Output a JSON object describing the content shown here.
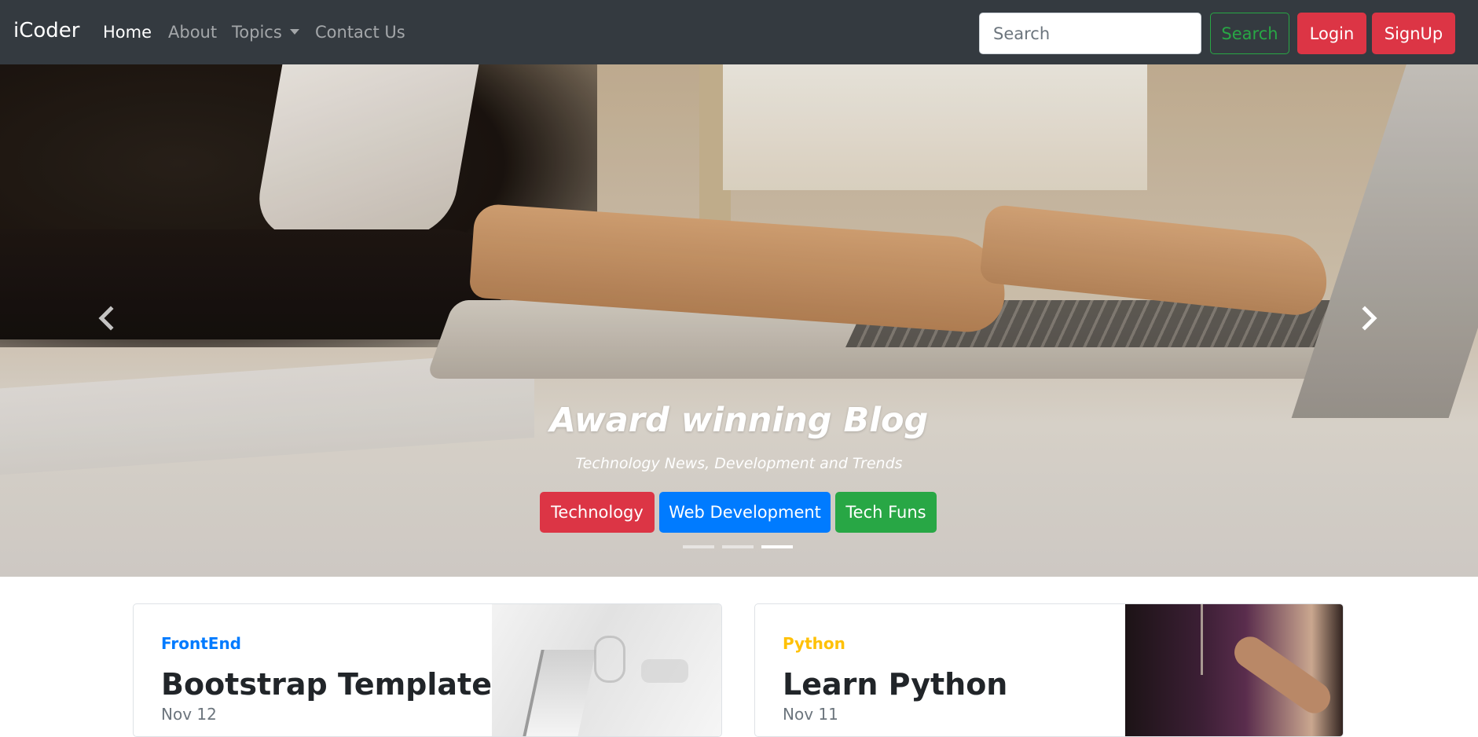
{
  "navbar": {
    "brand": "iCoder",
    "links": [
      {
        "label": "Home",
        "active": true
      },
      {
        "label": "About"
      },
      {
        "label": "Topics",
        "dropdown": true
      },
      {
        "label": "Contact Us"
      }
    ],
    "search_placeholder": "Search",
    "search_button": "Search",
    "login_button": "Login",
    "signup_button": "SignUp"
  },
  "carousel": {
    "title": "Award winning Blog",
    "subtitle": "Technology News, Development and Trends",
    "buttons": [
      {
        "label": "Technology",
        "color": "#dc3545"
      },
      {
        "label": "Web Development",
        "color": "#007bff"
      },
      {
        "label": "Tech Funs",
        "color": "#28a745"
      }
    ],
    "slide_count": 3,
    "active_slide": 3,
    "prev_icon": "chevron-left-icon",
    "next_icon": "chevron-right-icon"
  },
  "cards": [
    {
      "category": "FrontEnd",
      "category_color": "#007bff",
      "title": "Bootstrap Templates",
      "date": "Nov 12"
    },
    {
      "category": "Python",
      "category_color": "#ffc107",
      "title": "Learn Python",
      "date": "Nov 11"
    }
  ],
  "colors": {
    "navbar_bg": "#343a40",
    "danger": "#dc3545",
    "primary": "#007bff",
    "success": "#28a745",
    "warning": "#ffc107"
  }
}
